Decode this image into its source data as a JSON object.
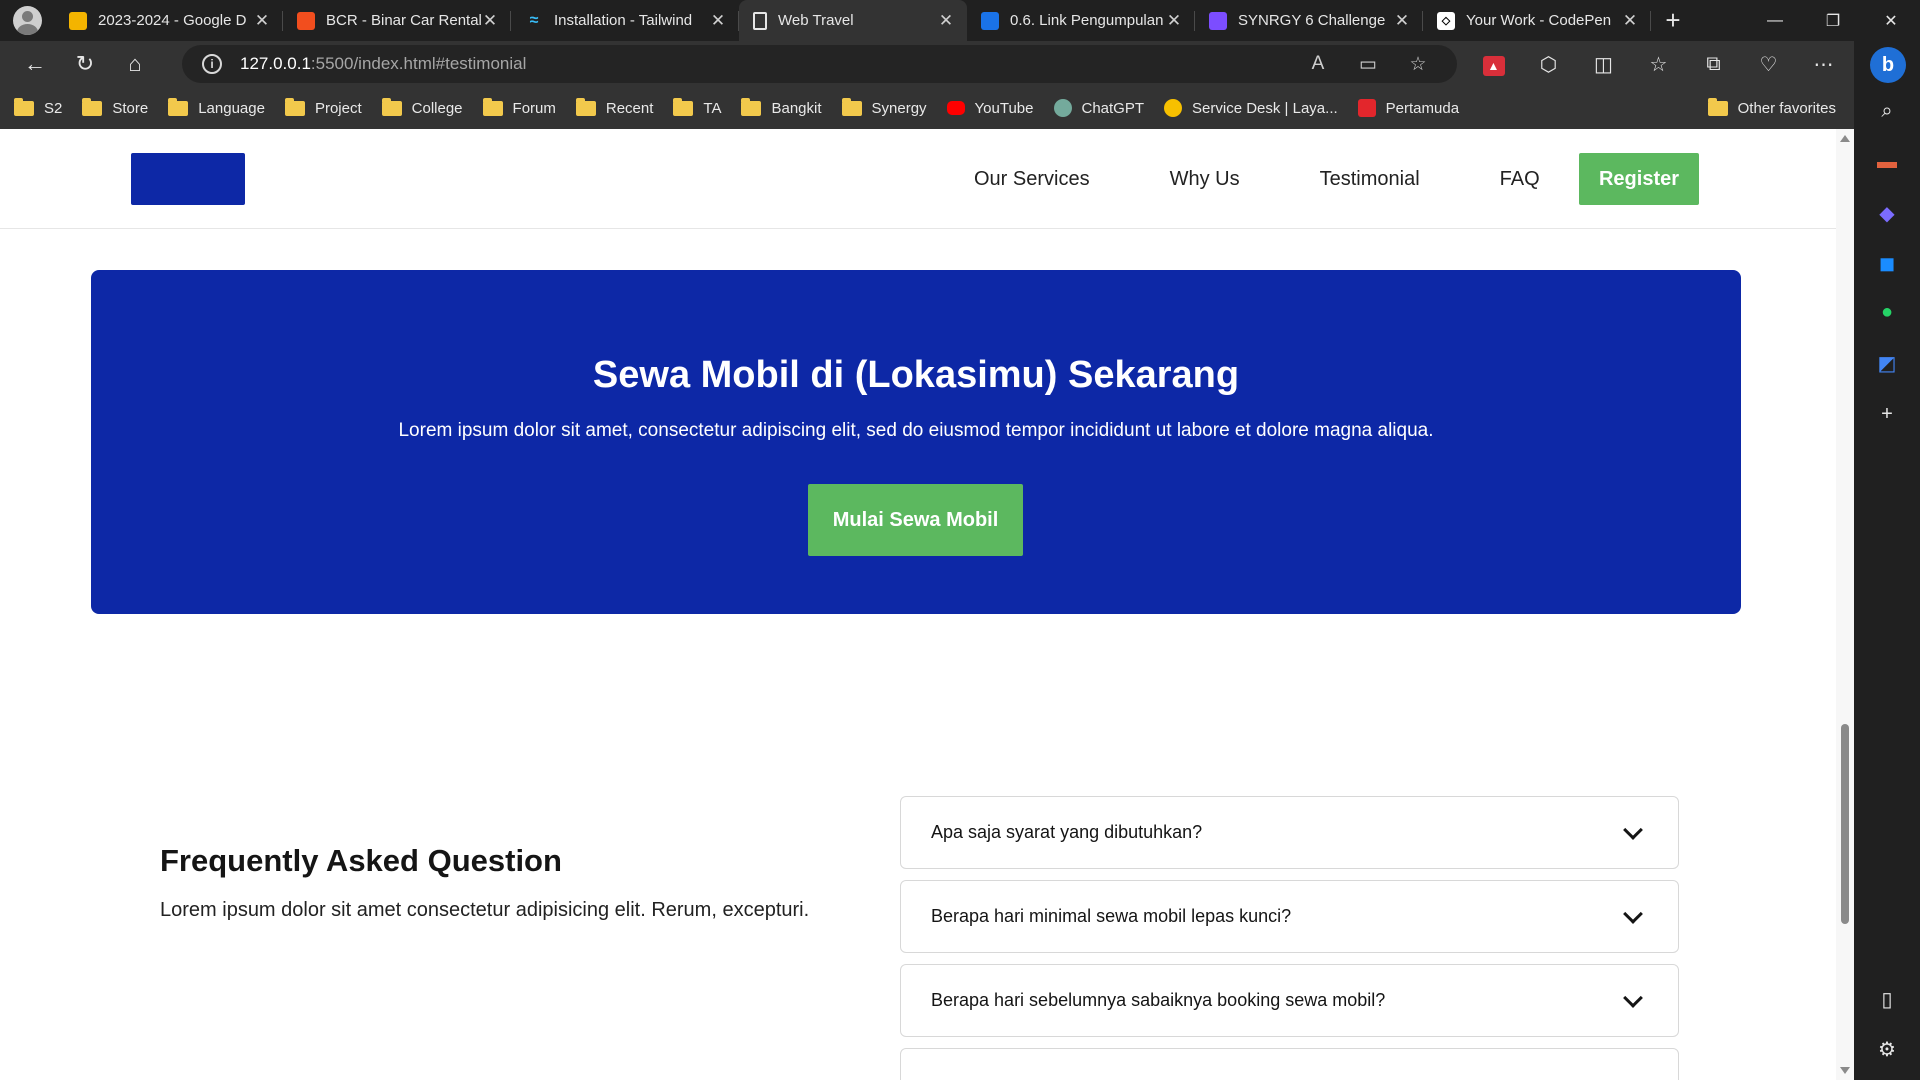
{
  "tabs": [
    {
      "title": "2023-2024 - Google D",
      "icon": "google-drive-icon",
      "color": "#f4b400"
    },
    {
      "title": "BCR - Binar Car Rental",
      "icon": "figma-icon",
      "color": "#f24e1e"
    },
    {
      "title": "Installation - Tailwind",
      "icon": "tailwind-icon",
      "color": "#38bdf8"
    },
    {
      "title": "Web Travel",
      "icon": "document-icon",
      "color": "#ffffff"
    },
    {
      "title": "0.6. Link Pengumpulan",
      "icon": "google-classroom-icon",
      "color": "#1a73e8"
    },
    {
      "title": "SYNRGY 6 Challenge",
      "icon": "forms-icon",
      "color": "#7c4dff"
    },
    {
      "title": "Your Work - CodePen",
      "icon": "codepen-icon",
      "color": "#ffffff"
    }
  ],
  "address": {
    "host": "127.0.0.1",
    "path": ":5500/index.html#testimonial"
  },
  "bookmarks": [
    {
      "label": "S2",
      "type": "folder"
    },
    {
      "label": "Store",
      "type": "folder"
    },
    {
      "label": "Language",
      "type": "folder"
    },
    {
      "label": "Project",
      "type": "folder"
    },
    {
      "label": "College",
      "type": "folder"
    },
    {
      "label": "Forum",
      "type": "folder"
    },
    {
      "label": "Recent",
      "type": "folder"
    },
    {
      "label": "TA",
      "type": "folder"
    },
    {
      "label": "Bangkit",
      "type": "folder"
    },
    {
      "label": "Synergy",
      "type": "folder"
    },
    {
      "label": "YouTube",
      "type": "site",
      "color": "#ff0000"
    },
    {
      "label": "ChatGPT",
      "type": "site",
      "color": "#74aa9c"
    },
    {
      "label": "Service Desk | Laya...",
      "type": "site",
      "color": "#f7c000"
    },
    {
      "label": "Pertamuda",
      "type": "site",
      "color": "#e3262c"
    }
  ],
  "other_favorites": "Other favorites",
  "nav": {
    "links": [
      "Our Services",
      "Why Us",
      "Testimonial",
      "FAQ"
    ],
    "register": "Register"
  },
  "cta": {
    "title": "Sewa Mobil di (Lokasimu) Sekarang",
    "subtitle": "Lorem ipsum dolor sit amet, consectetur adipiscing elit, sed do eiusmod tempor incididunt ut labore et dolore magna aliqua.",
    "button": "Mulai Sewa Mobil"
  },
  "faq": {
    "title": "Frequently Asked Question",
    "description": "Lorem ipsum dolor sit amet consectetur adipisicing elit. Rerum, excepturi.",
    "questions": [
      "Apa saja syarat yang dibutuhkan?",
      "Berapa hari minimal sewa mobil lepas kunci?",
      "Berapa hari sebelumnya sabaiknya booking sewa mobil?"
    ]
  },
  "colors": {
    "primary": "#0d28a6",
    "accent": "#5cb85f"
  }
}
